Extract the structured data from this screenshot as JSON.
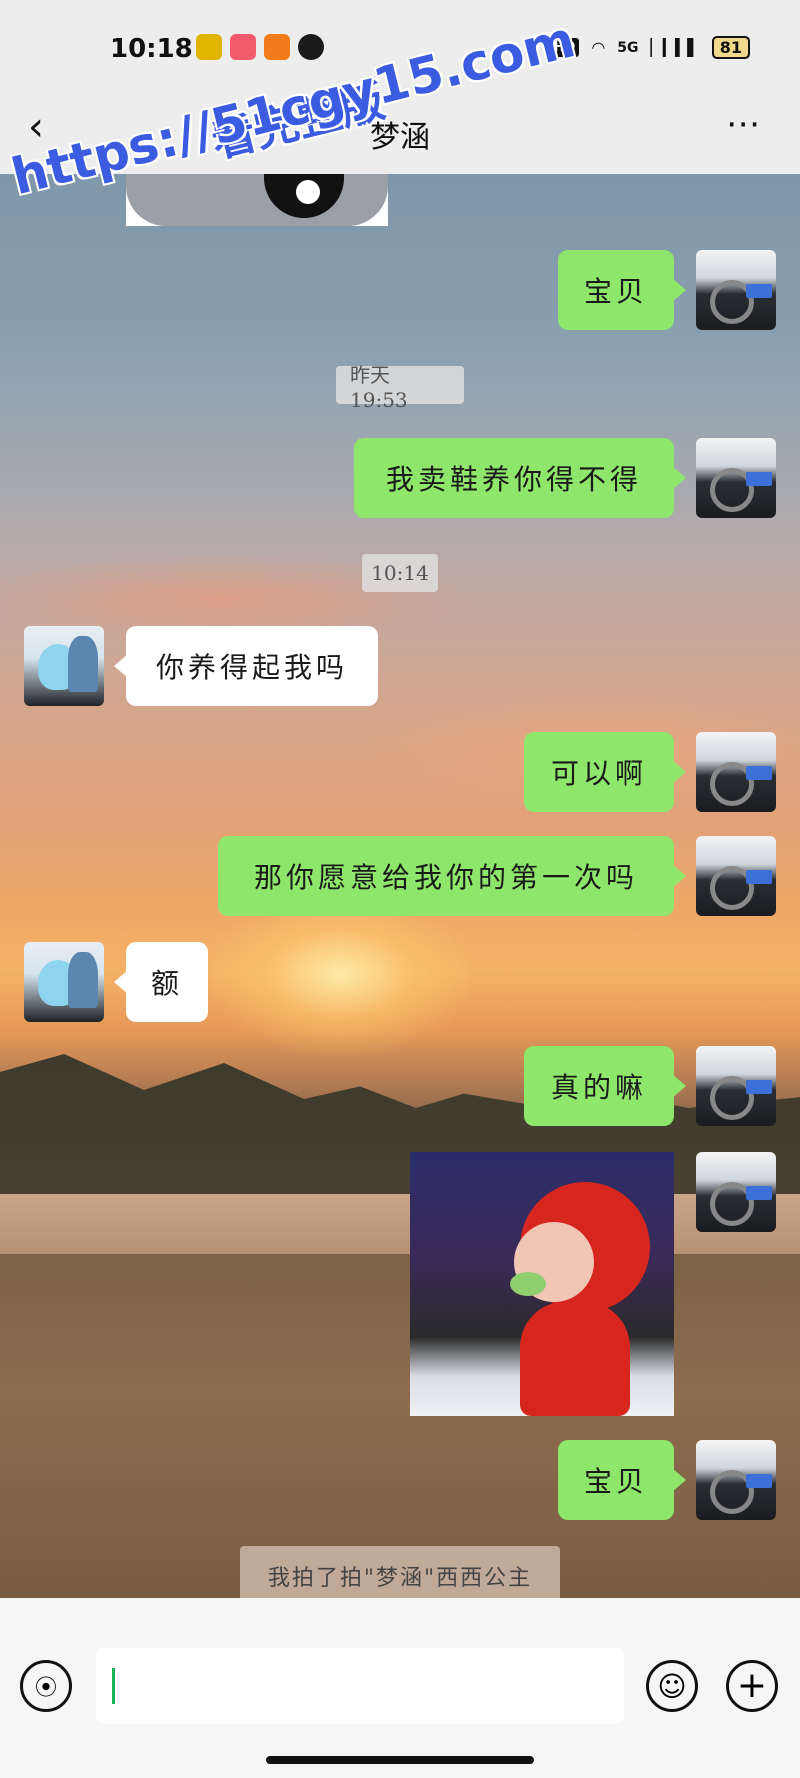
{
  "status_bar": {
    "time": "10:18",
    "hd": "HD",
    "network": "5G",
    "battery": "81"
  },
  "header": {
    "title": "梦涵",
    "back_icon": "chevron-left-icon",
    "more_icon": "more-dots-icon"
  },
  "watermark": {
    "url": "https://51cgy15.com",
    "subtitle": "看完整版"
  },
  "messages": [
    {
      "side": "right",
      "type": "text",
      "text": "宝贝"
    },
    {
      "type": "timestamp",
      "text": "昨天 19:53"
    },
    {
      "side": "right",
      "type": "text",
      "text": "我卖鞋养你得不得"
    },
    {
      "type": "timestamp",
      "text": "10:14"
    },
    {
      "side": "left",
      "type": "text",
      "text": "你养得起我吗"
    },
    {
      "side": "right",
      "type": "text",
      "text": "可以啊"
    },
    {
      "side": "right",
      "type": "text",
      "text": "那你愿意给我你的第一次吗"
    },
    {
      "side": "left",
      "type": "text",
      "text": "额"
    },
    {
      "side": "right",
      "type": "text",
      "text": "真的嘛"
    },
    {
      "side": "right",
      "type": "sticker",
      "sticker": "cartoon-pig-sticker"
    },
    {
      "side": "right",
      "type": "text",
      "text": "宝贝"
    }
  ],
  "system_notice": "我拍了拍\"梦涵\"西西公主",
  "input_bar": {
    "value": "",
    "voice_icon": "voice-icon",
    "emoji_icon": "emoji-icon",
    "plus_icon": "plus-icon"
  },
  "colors": {
    "outgoing_bubble": "#8ee76a",
    "incoming_bubble": "#ffffff",
    "watermark": "#3b5be0"
  }
}
